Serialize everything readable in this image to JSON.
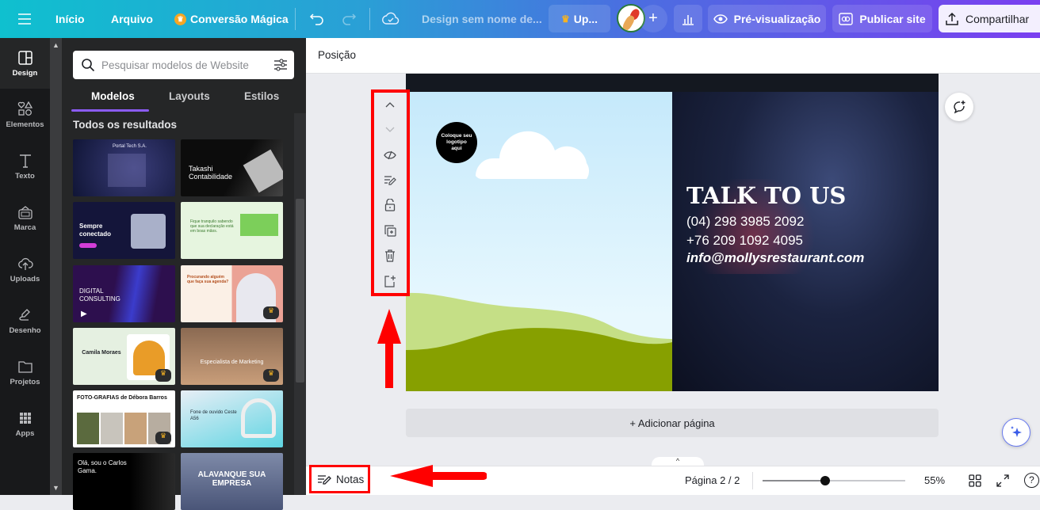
{
  "topbar": {
    "menu_icon": "hamburger-icon",
    "home": "Início",
    "file": "Arquivo",
    "magic": "Conversão Mágica",
    "design_name": "Design sem nome de...",
    "upgrade": "Up...",
    "preview": "Pré-visualização",
    "publish": "Publicar site",
    "share": "Compartilhar"
  },
  "rail": {
    "items": [
      {
        "label": "Design",
        "icon": "layout-icon"
      },
      {
        "label": "Elementos",
        "icon": "shapes-icon"
      },
      {
        "label": "Texto",
        "icon": "text-icon"
      },
      {
        "label": "Marca",
        "icon": "brand-icon"
      },
      {
        "label": "Uploads",
        "icon": "cloud-upload-icon"
      },
      {
        "label": "Desenho",
        "icon": "draw-icon"
      },
      {
        "label": "Projetos",
        "icon": "folder-icon"
      },
      {
        "label": "Apps",
        "icon": "apps-grid-icon"
      }
    ]
  },
  "panel": {
    "search_placeholder": "Pesquisar modelos de Website",
    "tabs": [
      "Modelos",
      "Layouts",
      "Estilos"
    ],
    "results_label": "Todos os resultados",
    "templates": [
      {
        "title": "Portal Tech S.A.",
        "premium": false
      },
      {
        "title": "Takashi Contabilidade",
        "premium": false
      },
      {
        "title": "Sempre conectado",
        "premium": false
      },
      {
        "title": "Fique tranquilo sabendo que sua declaração está em boas mãos.",
        "premium": false
      },
      {
        "title": "DIGITAL CONSULTING",
        "premium": false
      },
      {
        "title": "Procurando alguém que faça sua agenda?",
        "premium": true
      },
      {
        "title": "Camila Moraes",
        "premium": true
      },
      {
        "title": "Especialista de Marketing",
        "premium": true
      },
      {
        "title": "FOTO-GRAFIAS de Débora Barros",
        "premium": true
      },
      {
        "title": "Fone de ouvido Ceste A56",
        "premium": false
      },
      {
        "title": "Olá, sou o Carlos Gama.",
        "premium": false
      },
      {
        "title": "ALAVANQUE SUA EMPRESA",
        "premium": false
      }
    ]
  },
  "context": {
    "position": "Posição"
  },
  "canvas": {
    "logo_placeholder": "Coloque seu logotipo aqui",
    "heading": "TALK TO US",
    "phone1": "(04) 298 3985 2092",
    "phone2": "+76 209 1092 4095",
    "email": "info@mollysrestaurant.com",
    "add_page": "+ Adicionar página"
  },
  "bottombar": {
    "notes": "Notas",
    "page_indicator": "Página 2 / 2",
    "zoom_level": "55%",
    "zoom_fraction": 0.44
  },
  "colors": {
    "annotation": "#ff0000",
    "accent": "#8b5cf6"
  }
}
